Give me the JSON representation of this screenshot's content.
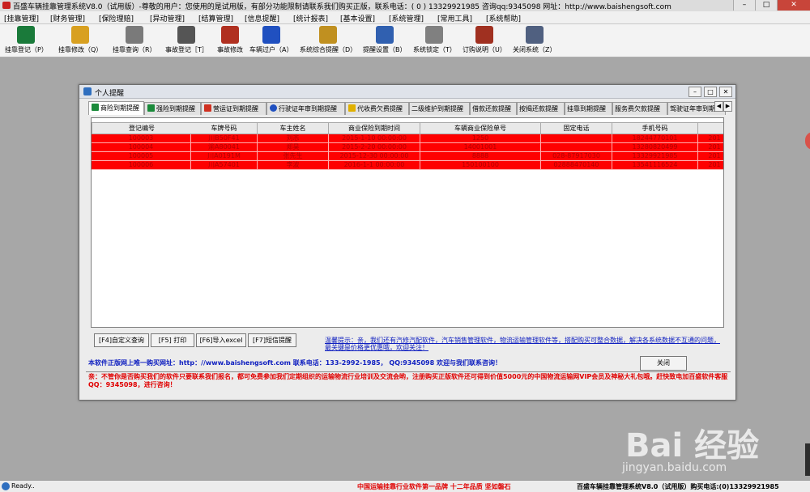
{
  "window": {
    "title": "百盛车辆挂靠管理系统V8.0（试用版）-尊敬的用户：您使用的是试用版，有部分功能限制请联系我们购买正版，联系电话：( 0 ) 13329921985 咨询qq:9345098 网址：http://www.baishengsoft.com",
    "minimize": "–",
    "maximize": "□",
    "close": "✕"
  },
  "menu": [
    "[挂靠管理]",
    "[财务管理]",
    "[保险理赔]",
    "[异动管理]",
    "[结算管理]",
    "[信息提醒]",
    "[统计报表]",
    "[基本设置]",
    "[系统管理]",
    "[常用工具]",
    "[系统帮助]"
  ],
  "toolbar": [
    {
      "label": "挂靠登记（P）",
      "icon": "register-monitor-icon",
      "color": "#1a7a3a"
    },
    {
      "label": "挂靠修改（Q）",
      "icon": "edit-folder-icon",
      "color": "#d8a020"
    },
    {
      "label": "挂靠查询（R）",
      "icon": "search-printer-icon",
      "color": "#7a7a7a"
    },
    {
      "label": "事故登记［T］",
      "icon": "cube-icon",
      "color": "#555555"
    },
    {
      "label": "事故修改",
      "icon": "accident-edit-icon",
      "color": "#b03020"
    },
    {
      "label": "车辆过户（A）",
      "icon": "transfer-user-icon",
      "color": "#2050c0"
    },
    {
      "label": "系统综合提醒（D）",
      "icon": "reminder-people-icon",
      "color": "#c09020"
    },
    {
      "label": "提醒设置（B）",
      "icon": "settings-gear-icon",
      "color": "#3060b0"
    },
    {
      "label": "系统锁定（T）",
      "icon": "lock-icon",
      "color": "#808080"
    },
    {
      "label": "订购说明（U）",
      "icon": "book-icon",
      "color": "#a03020"
    },
    {
      "label": "关闭系统（Z）",
      "icon": "exit-computer-icon",
      "color": "#506080"
    }
  ],
  "dialog": {
    "title": "个人提醒",
    "tabs": [
      {
        "label": "商险到期提醒",
        "icon_color": "#1a8a3a"
      },
      {
        "label": "强险到期提醒",
        "icon_color": "#1a8a3a"
      },
      {
        "label": "营运证到期提醒",
        "icon_color": "#d03020"
      },
      {
        "label": "行驶证年审到期提醒",
        "icon_color": "#2050c0"
      },
      {
        "label": "代收费欠费提醒",
        "icon_color": "#e0b000"
      },
      {
        "label": "二级维护到期提醒",
        "icon_color": ""
      },
      {
        "label": "借款还款提醒",
        "icon_color": ""
      },
      {
        "label": "按揭还款提醒",
        "icon_color": ""
      },
      {
        "label": "挂靠到期提醒",
        "icon_color": ""
      },
      {
        "label": "服务费欠款提醒",
        "icon_color": ""
      },
      {
        "label": "驾驶证年审到期",
        "icon_color": ""
      }
    ],
    "tab_scroll": [
      "◀",
      "▶"
    ],
    "table": {
      "columns": [
        "登记编号",
        "车牌号码",
        "车主姓名",
        "商业保险到期时间",
        "车辆商业保险单号",
        "固定电话",
        "手机号码",
        ""
      ],
      "rows": [
        [
          "100003",
          "川B50F41",
          "刘忞",
          "2015-1-10 00:00:00",
          "1250",
          "",
          "18244770101",
          "201"
        ],
        [
          "100004",
          "渝A80041",
          "郑昊",
          "2015-2-20 00:00:00",
          "14001001",
          "",
          "13280820499",
          "201"
        ],
        [
          "100005",
          "川A0191M",
          "张先生",
          "2015-12-30 00:00:00",
          "8888",
          "028-87917030",
          "13329921985",
          "201"
        ],
        [
          "100006",
          "川A57401",
          "李波",
          "2016-1-1 00:00:00",
          "150100100",
          "02888470140",
          "13541116524",
          "201"
        ]
      ]
    },
    "buttons": [
      "[F4]自定义查询",
      "[F5] 打印",
      "[F6]导入excel",
      "[F7]短信提醒"
    ],
    "tip": "温馨提示：亲，我们还有汽修汽配软件，汽车销售管理软件，物流运输管理软件等，搭配购买可整合数据，解决各系统数据不互通的问题，最关键是价格更优惠哦，欢迎关注！",
    "buy_line": "本软件正版网上唯一购买网址：http：//www.baishengsoft.com  联系电话：133-2992-1985， QQ:9345098 欢迎与我们联系咨询！",
    "close_label": "关闭",
    "notice": "亲：不管你是否购买我们的软件只要联系我们报名，都可免费参加我们定期组织的运输物流行业培训及交流会哟，注册购买正版软件还可得到价值5000元的中国物流运输网VIP会员及神秘大礼包哦。赶快致电加百盛软件客服QQ：9345098，进行咨询！"
  },
  "status": {
    "ready": "Ready..",
    "slogan": "中国运输挂靠行业软件第一品牌    十二年品质 坚如磐石",
    "system": "百盛车辆挂靠管理系统V8.0（试用版）购买电话:(0)13329921985"
  },
  "watermark": {
    "brand": "Bai 经验",
    "site": "jingyan.baidu.com"
  }
}
